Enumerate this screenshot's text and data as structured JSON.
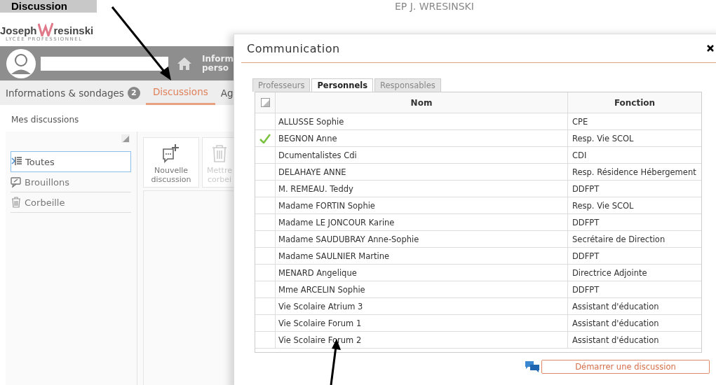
{
  "annotation_label": "Discussion",
  "logo": {
    "name_part1": "Joseph",
    "name_part2": "resinski",
    "subtitle": "LYCÉE PROFESSIONNEL"
  },
  "header_title": "EP J. WRESINSKI",
  "nav": {
    "home_label_line1": "Inform",
    "home_label_line2": "perso"
  },
  "main_tabs": [
    {
      "label": "Informations & sondages",
      "badge": "2",
      "selected": false
    },
    {
      "label": "Discussions",
      "selected": true
    },
    {
      "label": "Ag",
      "selected": false
    }
  ],
  "section_title": "Mes discussions",
  "folders": [
    {
      "label": "Toutes",
      "selected": true
    },
    {
      "label": "Brouillons",
      "selected": false
    },
    {
      "label": "Corbeille",
      "selected": false
    }
  ],
  "toolbar": [
    {
      "label": "Nouvelle discussion",
      "disabled": false
    },
    {
      "label": "Mettre corbei",
      "disabled": true
    }
  ],
  "dialog": {
    "title": "Communication",
    "tabs": [
      {
        "label": "Professeurs",
        "selected": false
      },
      {
        "label": "Personnels",
        "selected": true
      },
      {
        "label": "Responsables",
        "selected": false
      }
    ],
    "columns": [
      "Nom",
      "Fonction"
    ],
    "rows": [
      {
        "name": "ALLUSSE Sophie",
        "role": "CPE",
        "checked": false
      },
      {
        "name": "BEGNON Anne",
        "role": "Resp. Vie SCOL",
        "checked": true
      },
      {
        "name": "Dcumentalistes Cdi",
        "role": "CDI",
        "checked": false
      },
      {
        "name": "DELAHAYE ANNE",
        "role": "Resp. Résidence Hébergement",
        "checked": false
      },
      {
        "name": "M. REMEAU. Teddy",
        "role": "DDFPT",
        "checked": false
      },
      {
        "name": "Madame FORTIN Sophie",
        "role": "Resp. Vie SCOL",
        "checked": false
      },
      {
        "name": "Madame LE JONCOUR Karine",
        "role": "DDFPT",
        "checked": false
      },
      {
        "name": "Madame SAUDUBRAY Anne-Sophie",
        "role": "Secrétaire de Direction",
        "checked": false
      },
      {
        "name": "Madame SAULNIER Martine",
        "role": "DDFPT",
        "checked": false
      },
      {
        "name": "MENARD Angelique",
        "role": "Directrice Adjointe",
        "checked": false
      },
      {
        "name": "Mme ARCELIN Sophie",
        "role": "DDFPT",
        "checked": false
      },
      {
        "name": "Vie Scolaire Atrium 3",
        "role": "Assistant d'éducation",
        "checked": false
      },
      {
        "name": "Vie Scolaire Forum 1",
        "role": "Assistant d'éducation",
        "checked": false
      },
      {
        "name": "Vie Scolaire Forum 2",
        "role": "Assistant d'éducation",
        "checked": false
      }
    ],
    "start_button": "Démarrer une discussion"
  }
}
